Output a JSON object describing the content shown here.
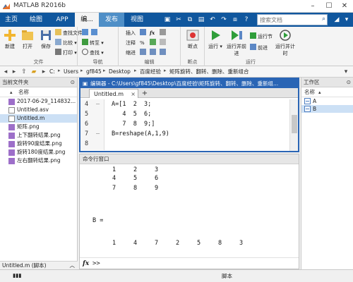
{
  "app": {
    "title": "MATLAB R2016b"
  },
  "tabs": [
    "主页",
    "绘图",
    "APP",
    "编...",
    "发布",
    "视图"
  ],
  "search": {
    "placeholder": "搜索文档"
  },
  "toolstrip": {
    "file": {
      "label": "文件",
      "new": "新建",
      "open": "打开",
      "save": "保存",
      "find_files": "查找文件",
      "compare": "比较",
      "print": "打印"
    },
    "navigate": {
      "label": "导航",
      "goto": "转至",
      "find": "查找"
    },
    "edit": {
      "label": "编辑",
      "insert": "插入",
      "comment": "注释",
      "indent": "缩进",
      "fx": "fx"
    },
    "breakpoints": {
      "label": "断点",
      "breakpoints": "断点"
    },
    "run": {
      "label": "运行",
      "run": "运行",
      "run_advance": "运行并前进",
      "run_section": "运行节",
      "advance": "前进",
      "run_time": "运行并计时"
    }
  },
  "address": {
    "crumbs": [
      "C:",
      "Users",
      "gf845",
      "Desktop",
      "百度经验",
      "矩阵旋转、翻转、删除、重新组合"
    ]
  },
  "current_folder": {
    "title": "当前文件夹",
    "column": "名称",
    "files": [
      "2017-06-29_114832...",
      "Untitled.asv",
      "Untitled.m",
      "矩阵.png",
      "上下翻转结果.png",
      "旋转90度结果.png",
      "旋转180度结果.png",
      "左右翻转结果.png"
    ],
    "selected_index": 2,
    "footer": "Untitled.m (脚本)"
  },
  "editor": {
    "title": "编辑器 - C:\\Users\\gf845\\Desktop\\百度经验\\矩阵旋转、翻转、删除、重新组...",
    "tab": "Untitled.m",
    "lines": [
      {
        "num": "4",
        "dash": "—",
        "text": "A=[1  2  3;"
      },
      {
        "num": "5",
        "dash": "",
        "text": "   4  5  6;"
      },
      {
        "num": "6",
        "dash": "",
        "text": "   7  8  9;]"
      },
      {
        "num": "7",
        "dash": "—",
        "text": "B=reshape(A,1,9)"
      },
      {
        "num": "8",
        "dash": "",
        "text": ""
      }
    ]
  },
  "command_window": {
    "title": "命令行窗口",
    "rows": [
      [
        "1",
        "2",
        "3"
      ],
      [
        "4",
        "5",
        "6"
      ],
      [
        "7",
        "8",
        "9"
      ]
    ],
    "b_label": "B =",
    "b_values": [
      "1",
      "4",
      "7",
      "2",
      "5",
      "8",
      "3"
    ],
    "prompt": ">>"
  },
  "workspace": {
    "title": "工作区",
    "column": "名称",
    "vars": [
      "A",
      "B"
    ],
    "selected_index": 1
  },
  "status": {
    "script": "脚本"
  },
  "colors": {
    "tab_bar": "#10579e",
    "editor_border": "#2a65b5",
    "selection": "#cce0f5"
  }
}
